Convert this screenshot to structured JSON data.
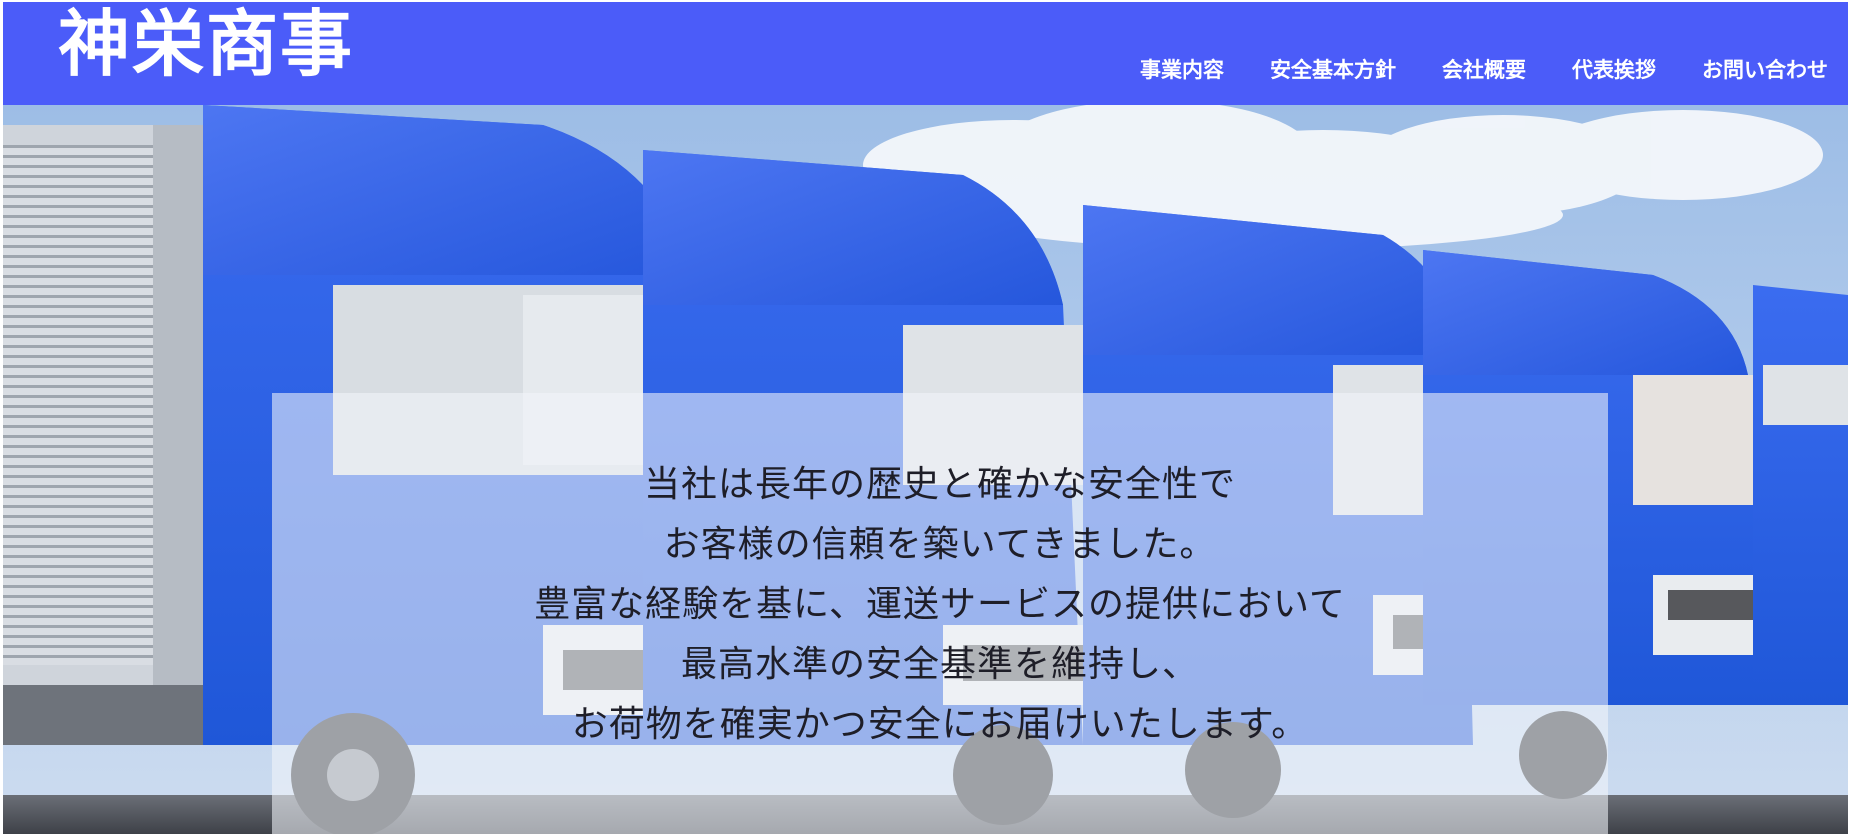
{
  "site": {
    "logo_text": "神栄商事"
  },
  "nav": {
    "items": [
      {
        "label": "事業内容"
      },
      {
        "label": "安全基本方針"
      },
      {
        "label": "会社概要"
      },
      {
        "label": "代表挨拶"
      },
      {
        "label": "お問い合わせ"
      }
    ]
  },
  "hero": {
    "message_lines": [
      "当社は長年の歴史と確かな安全性で",
      "お客様の信頼を築いてきました。",
      "豊富な経験を基に、運送サービスの提供において",
      "最高水準の安全基準を維持し、",
      "お荷物を確実かつ安全にお届けいたします。"
    ]
  },
  "colors": {
    "header_background": "#4b5cf9",
    "truck_blue": "#2f6fe6",
    "sky": "#a9c6ea",
    "text_white": "#ffffff",
    "message_text": "#1e1e28"
  }
}
